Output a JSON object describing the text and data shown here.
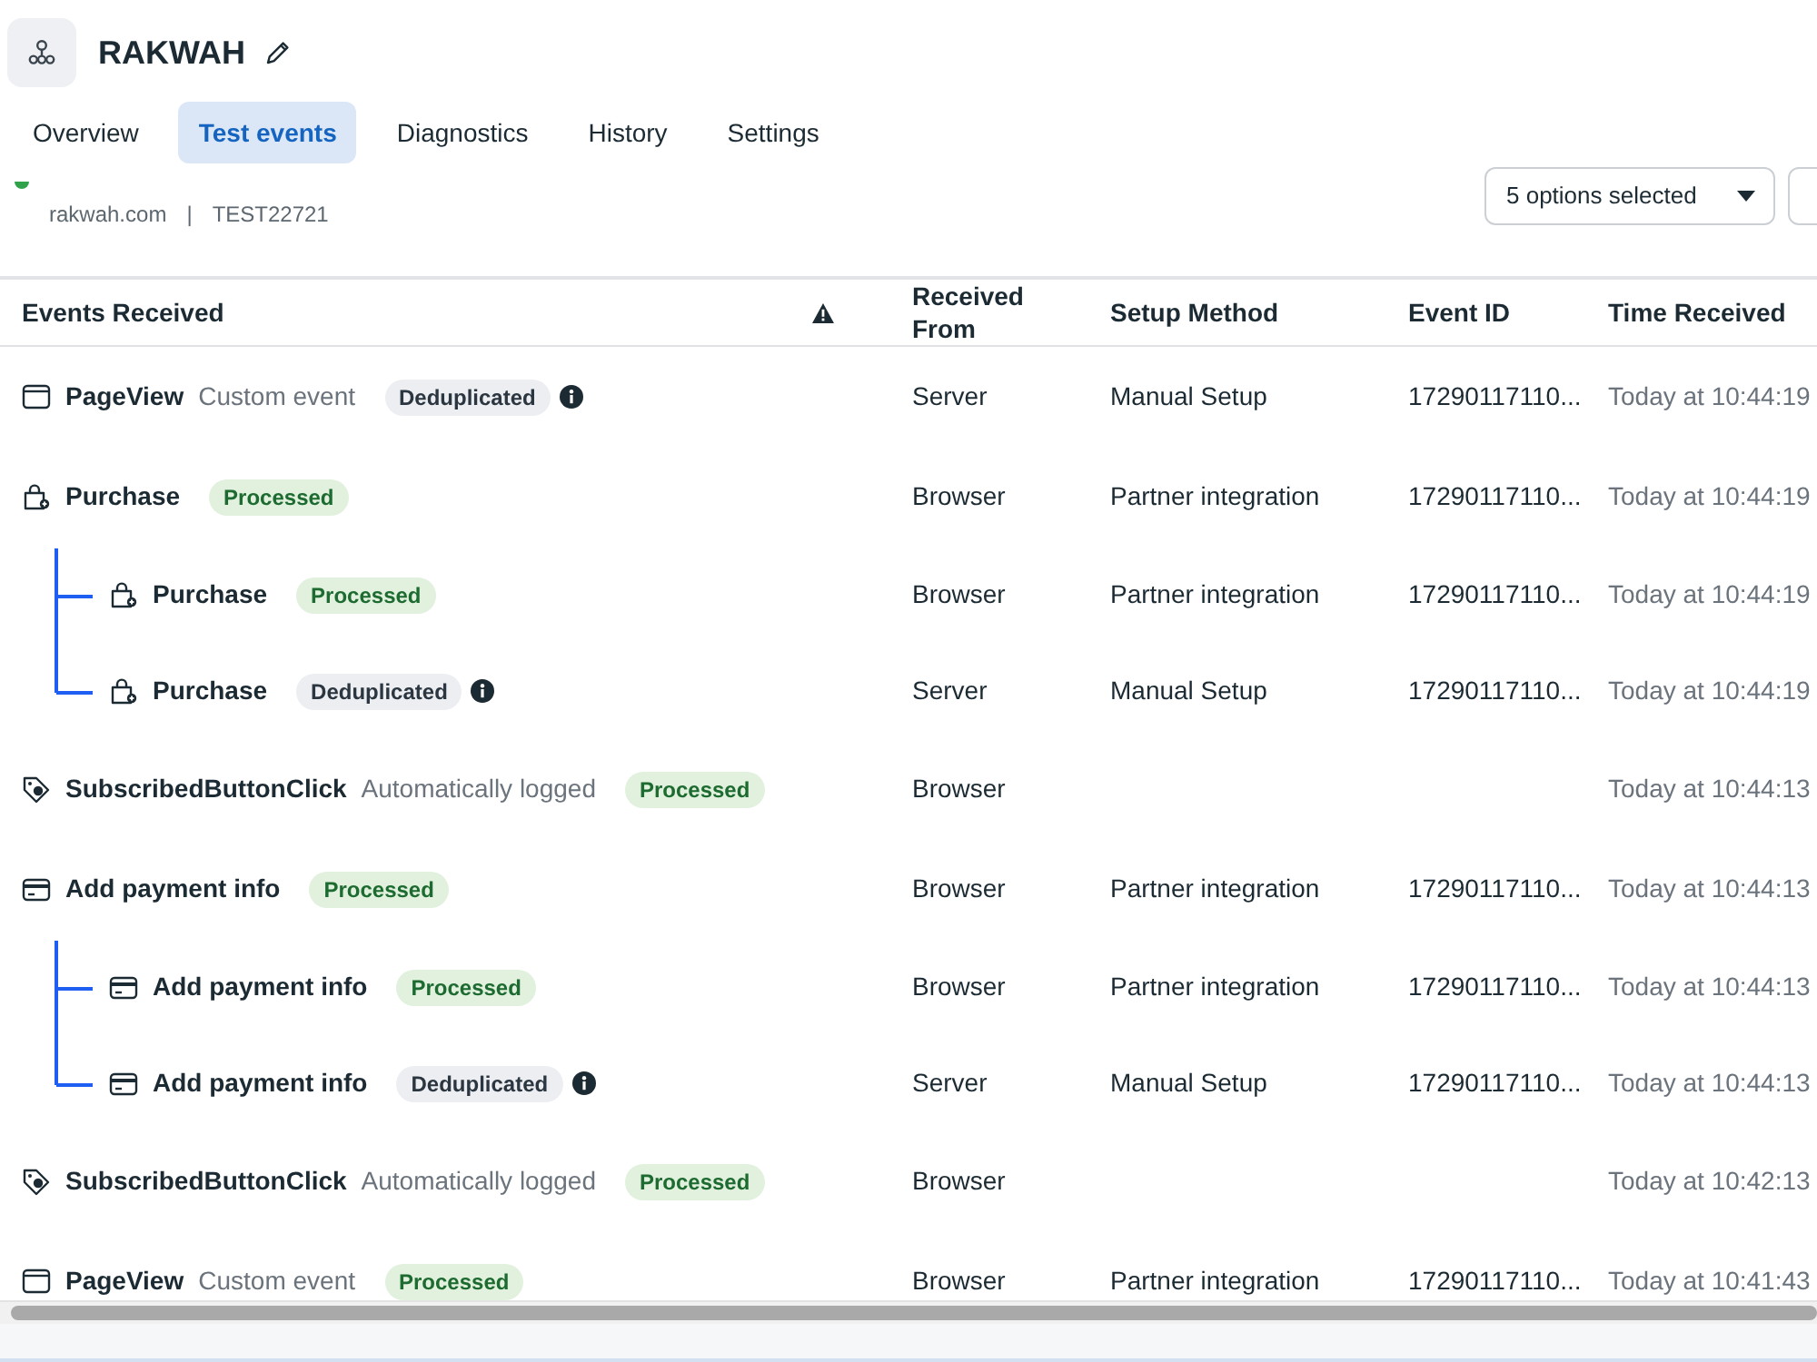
{
  "header": {
    "title": "RAKWAH"
  },
  "tabs": [
    {
      "label": "Overview",
      "selected": false
    },
    {
      "label": "Test events",
      "selected": true
    },
    {
      "label": "Diagnostics",
      "selected": false
    },
    {
      "label": "History",
      "selected": false
    },
    {
      "label": "Settings",
      "selected": false
    }
  ],
  "source": {
    "domain": "rakwah.com",
    "separator": "|",
    "code": "TEST22721"
  },
  "filter": {
    "value": "5 options selected"
  },
  "table": {
    "columns": [
      "Events Received",
      "Received From",
      "Setup Method",
      "Event ID",
      "Time Received"
    ],
    "rows": [
      {
        "kind": "pageview",
        "name": "PageView",
        "type_label": "Custom event",
        "badge": {
          "label": "Deduplicated",
          "kind": "deduplicated"
        },
        "received_from": "Server",
        "setup_method": "Manual Setup",
        "event_id": "17290117110...",
        "time_received": "Today at 10:44:19"
      },
      {
        "kind": "purchase",
        "name": "Purchase",
        "badge": {
          "label": "Processed",
          "kind": "processed"
        },
        "received_from": "Browser",
        "setup_method": "Partner integration",
        "event_id": "17290117110...",
        "time_received": "Today at 10:44:19",
        "children": [
          {
            "kind": "purchase",
            "name": "Purchase",
            "badge": {
              "label": "Processed",
              "kind": "processed"
            },
            "received_from": "Browser",
            "setup_method": "Partner integration",
            "event_id": "17290117110...",
            "time_received": "Today at 10:44:19"
          },
          {
            "kind": "purchase",
            "name": "Purchase",
            "badge": {
              "label": "Deduplicated",
              "kind": "deduplicated"
            },
            "received_from": "Server",
            "setup_method": "Manual Setup",
            "event_id": "17290117110...",
            "time_received": "Today at 10:44:19"
          }
        ]
      },
      {
        "kind": "click",
        "name": "SubscribedButtonClick",
        "type_label": "Automatically logged",
        "badge": {
          "label": "Processed",
          "kind": "processed"
        },
        "received_from": "Browser",
        "time_received": "Today at 10:44:13"
      },
      {
        "kind": "payment",
        "name": "Add payment info",
        "badge": {
          "label": "Processed",
          "kind": "processed"
        },
        "received_from": "Browser",
        "setup_method": "Partner integration",
        "event_id": "17290117110...",
        "time_received": "Today at 10:44:13",
        "children": [
          {
            "kind": "payment",
            "name": "Add payment info",
            "badge": {
              "label": "Processed",
              "kind": "processed"
            },
            "received_from": "Browser",
            "setup_method": "Partner integration",
            "event_id": "17290117110...",
            "time_received": "Today at 10:44:13"
          },
          {
            "kind": "payment",
            "name": "Add payment info",
            "badge": {
              "label": "Deduplicated",
              "kind": "deduplicated"
            },
            "received_from": "Server",
            "setup_method": "Manual Setup",
            "event_id": "17290117110...",
            "time_received": "Today at 10:44:13"
          }
        ]
      },
      {
        "kind": "click",
        "name": "SubscribedButtonClick",
        "type_label": "Automatically logged",
        "badge": {
          "label": "Processed",
          "kind": "processed"
        },
        "received_from": "Browser",
        "time_received": "Today at 10:42:13"
      },
      {
        "kind": "pageview",
        "name": "PageView",
        "type_label": "Custom event",
        "badge": {
          "label": "Processed",
          "kind": "processed"
        },
        "received_from": "Browser",
        "setup_method": "Partner integration",
        "event_id": "17290117110...",
        "time_received": "Today at 10:41:43"
      }
    ]
  }
}
